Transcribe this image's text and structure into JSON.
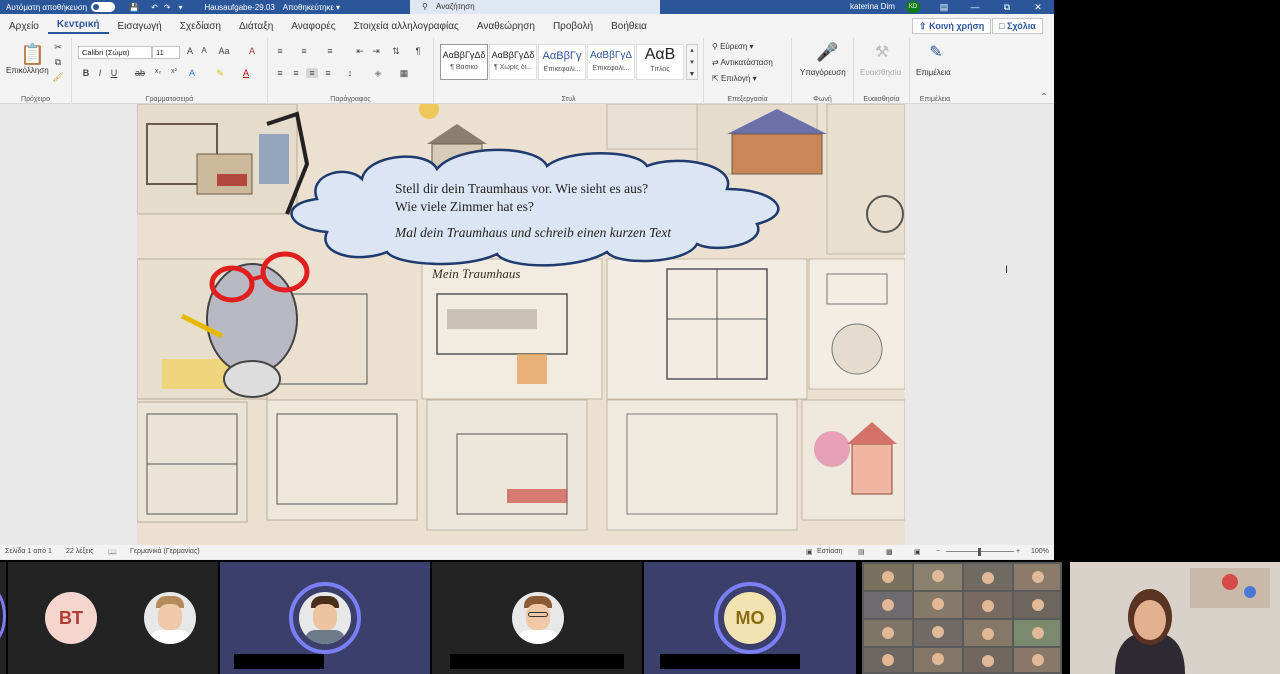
{
  "titlebar": {
    "autosave_label": "Αυτόματη αποθήκευση",
    "document_name": "Hausaufgabe-29.03",
    "save_status": "Αποθηκεύτηκε",
    "search_placeholder": "Αναζήτηση",
    "user_name": "katerina Dim",
    "user_initials": "KD"
  },
  "menu": {
    "tabs": [
      "Αρχείο",
      "Κεντρική",
      "Εισαγωγή",
      "Σχεδίαση",
      "Διάταξη",
      "Αναφορές",
      "Στοιχεία αλληλογραφίας",
      "Αναθεώρηση",
      "Προβολή",
      "Βοήθεια"
    ],
    "active_tab": "Κεντρική",
    "share_label": "Κοινή χρήση",
    "comments_label": "Σχόλια"
  },
  "ribbon": {
    "clipboard": {
      "paste_label": "Επικόλληση",
      "group_label": "Πρόχειρο"
    },
    "font": {
      "font_name": "Calibri (Σώμα)",
      "font_size": "11",
      "group_label": "Γραμματοσειρά"
    },
    "paragraph": {
      "group_label": "Παράγραφος"
    },
    "styles": {
      "group_label": "Στυλ",
      "items": [
        {
          "sample": "ΑαΒβΓγΔδ",
          "name": "¶ Βασικό"
        },
        {
          "sample": "ΑαΒβΓγΔδ",
          "name": "¶ Χωρίς δι..."
        },
        {
          "sample": "ΑαΒβΓγ",
          "name": "Επικεφαλί..."
        },
        {
          "sample": "ΑαΒβΓγΔ",
          "name": "Επικεφαλί..."
        },
        {
          "sample": "ΑαΒ",
          "name": "Τίτλος"
        }
      ]
    },
    "editing": {
      "find_label": "Εύρεση",
      "replace_label": "Αντικατάσταση",
      "select_label": "Επιλογή",
      "group_label": "Επεξεργασία"
    },
    "voice": {
      "dictate_label": "Υπαγόρευση",
      "group_label": "Φωνή"
    },
    "sensitivity": {
      "label": "Ευαισθησία",
      "group_label": "Ευαισθησία"
    },
    "editor": {
      "label": "Επιμέλεια",
      "group_label": "Επιμέλεια"
    }
  },
  "document": {
    "cloud_line1": "Stell dir dein Traumhaus vor. Wie sieht es aus?",
    "cloud_line2": "Wie viele Zimmer hat es?",
    "cloud_line3": "Mal dein Traumhaus und schreib einen kurzen Text",
    "poster_title": "Mein Traumhaus"
  },
  "status": {
    "page": "Σελίδα 1 από 1",
    "words": "22 λέξεις",
    "language": "Γερμανικά (Γερμανίας)",
    "focus": "Εστίαση",
    "zoom": "100%"
  },
  "participants": [
    {
      "initials": "BT",
      "type": "initials",
      "color": "#f5d6cf",
      "text_color": "#b23a33"
    },
    {
      "type": "photo",
      "active": false
    },
    {
      "type": "photo",
      "active": true
    },
    {
      "type": "photo",
      "active": false
    },
    {
      "initials": "MO",
      "type": "initials",
      "color": "#f3e3b0",
      "text_color": "#8a6a12",
      "active": true
    }
  ],
  "colors": {
    "word_blue": "#2b579a",
    "speaker_ring": "#7b7ff5",
    "cloud_fill": "#dbe5f4",
    "cloud_stroke": "#1e3a6e"
  }
}
